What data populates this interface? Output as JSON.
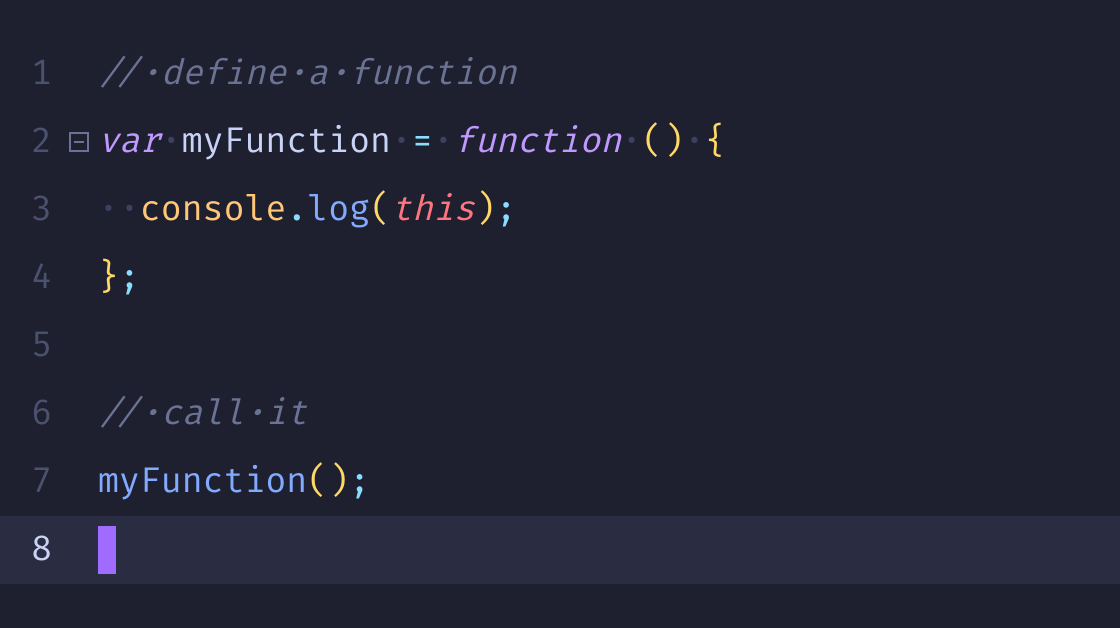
{
  "editor": {
    "lineNumbers": [
      "1",
      "2",
      "3",
      "4",
      "5",
      "6",
      "7",
      "8"
    ],
    "currentLine": 8,
    "foldable": {
      "2": true
    },
    "whitespaceDot": "·",
    "tokens": {
      "line1": {
        "commentSlashes": "//",
        "d1": "·",
        "w_define": "define",
        "d2": "·",
        "w_a": "a",
        "d3": "·",
        "w_function": "function"
      },
      "line2": {
        "kw_var": "var",
        "d1": "·",
        "ident": "myFunction",
        "d2": "·",
        "op_eq": "=",
        "d3": "·",
        "kw_function": "function",
        "d4": "·",
        "lparen": "(",
        "rparen": ")",
        "d5": "·",
        "lbrace": "{"
      },
      "line3": {
        "d1": "·",
        "d2": "·",
        "obj": "console",
        "dot": ".",
        "method": "log",
        "lparen": "(",
        "kw_this": "this",
        "rparen": ")",
        "semi": ";"
      },
      "line4": {
        "rbrace": "}",
        "semi": ";"
      },
      "line6": {
        "commentSlashes": "//",
        "d1": "·",
        "w_call": "call",
        "d2": "·",
        "w_it": "it"
      },
      "line7": {
        "ident": "myFunction",
        "lparen": "(",
        "rparen": ")",
        "semi": ";"
      }
    }
  },
  "colors": {
    "background": "#1e2030",
    "currentLine": "#2a2d42",
    "gutter": "#4b5270",
    "cursor": "#a06bff"
  }
}
